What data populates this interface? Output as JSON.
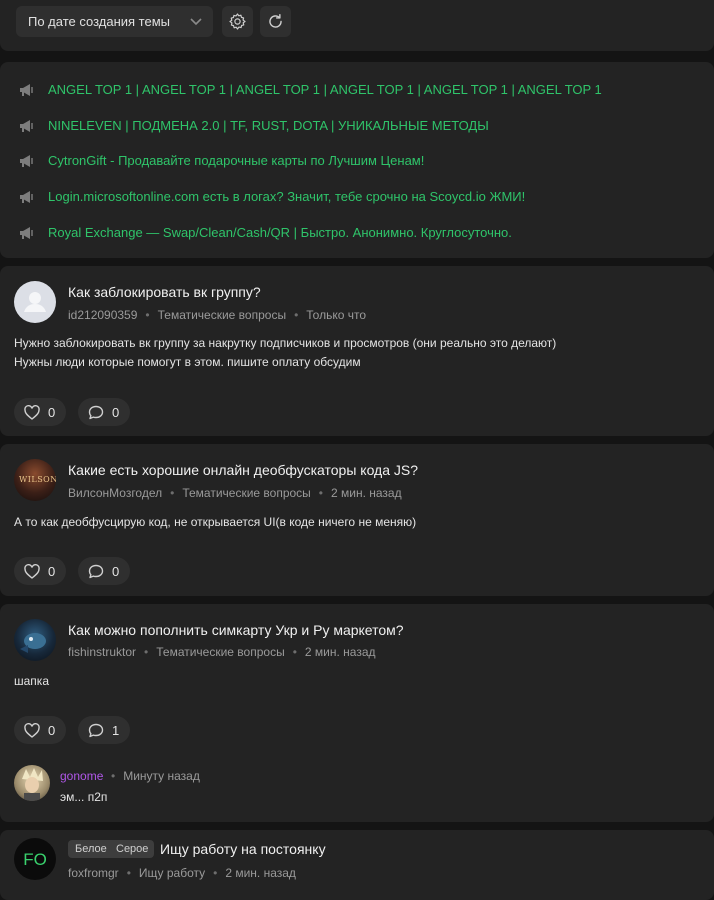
{
  "filter": {
    "sort_label": "По дате создания темы"
  },
  "promo": [
    "ANGEL TOP 1 | ANGEL TOP 1 | ANGEL TOP 1 | ANGEL TOP 1 | ANGEL TOP 1 | ANGEL TOP 1",
    "NINELEVEN | ПОДМЕНА 2.0 | TF, RUST, DOTA | УНИКАЛЬНЫЕ МЕТОДЫ",
    "CytronGift - Продавайте подарочные карты по Лучшим Ценам!",
    "Login.microsoftonline.com есть в логах? Значит, тебе срочно на Scoycd.io ЖМИ!",
    "Royal Exchange — Swap/Clean/Cash/QR | Быстро. Анонимно. Круглосуточно."
  ],
  "threads": [
    {
      "title": "Как заблокировать вк группу?",
      "author": "id212090359",
      "section": "Тематические вопросы",
      "time": "Только что",
      "body": [
        "Нужно заблокировать вк группу за накрутку подписчиков и просмотров (они реально это делают)",
        "Нужны люди которые помогут в этом. пишите оплату обсудим"
      ],
      "likes": "0",
      "comments": "0"
    },
    {
      "title": "Какие есть хорошие онлайн деобфускаторы кода JS?",
      "author": "ВилсонМозгодел",
      "section": "Тематические вопросы",
      "time": "2 мин. назад",
      "body": [
        "А то как деобфусцирую код, не открывается UI(в коде ничего не меняю)"
      ],
      "likes": "0",
      "comments": "0"
    },
    {
      "title": "Как можно пополнить симкарту Укр и Ру маркетом?",
      "author": "fishinstruktor",
      "section": "Тематические вопросы",
      "time": "2 мин. назад",
      "body": [
        "шапка"
      ],
      "likes": "0",
      "comments": "1",
      "last_comment": {
        "author": "gonome",
        "time": "Минуту назад",
        "text": "эм... п2п"
      }
    },
    {
      "tags": [
        "Белое",
        "Серое"
      ],
      "title": "Ищу работу на постоянку",
      "author": "foxfromgr",
      "section": "Ищу работу",
      "time": "2 мин. назад",
      "avatar_text": "FO"
    }
  ],
  "colors": {
    "accent_green": "#2fc46a",
    "commenter_purple": "#b057e8",
    "panel": "#232323",
    "bg": "#141414"
  }
}
